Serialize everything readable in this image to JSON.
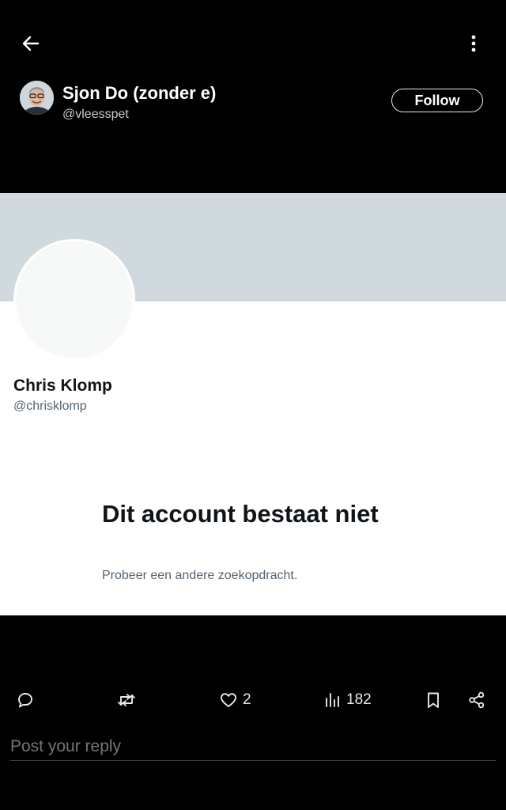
{
  "topbar": {
    "back_icon": "arrow-left-icon",
    "more_icon": "more-vertical-icon"
  },
  "author": {
    "name": "Sjon Do (zonder e)",
    "handle": "@vleesspet",
    "follow_label": "Follow"
  },
  "embedded_card": {
    "name": "Chris Klomp",
    "handle": "@chrisklomp",
    "title": "Dit account bestaat niet",
    "subtitle": "Probeer een andere zoekopdracht."
  },
  "actions": {
    "reply_icon": "reply-icon",
    "repost_icon": "repost-icon",
    "like_icon": "heart-icon",
    "like_count": "2",
    "views_icon": "views-icon",
    "views_count": "182",
    "bookmark_icon": "bookmark-icon",
    "share_icon": "share-icon"
  },
  "reply": {
    "placeholder": "Post your reply"
  },
  "colors": {
    "background": "#000000",
    "banner": "#cfd9de",
    "card_background": "#ffffff",
    "primary_text_dark": "#0f1419",
    "secondary_text": "#536471"
  }
}
